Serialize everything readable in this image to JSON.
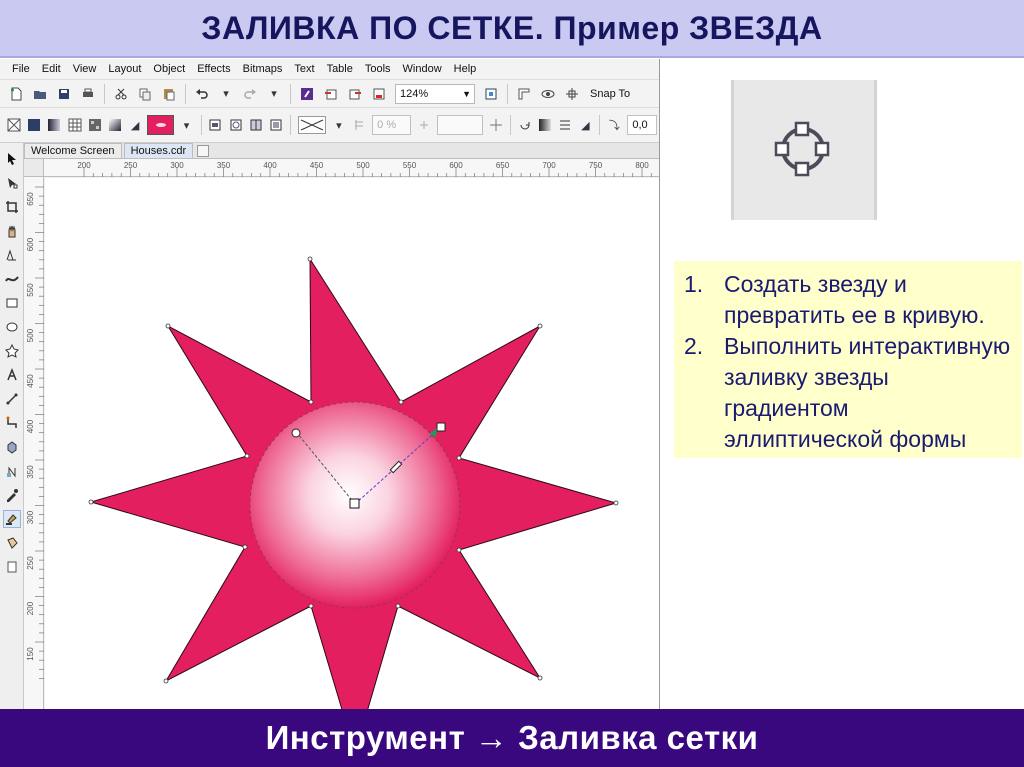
{
  "slide": {
    "title": "ЗАЛИВКА ПО СЕТКЕ. Пример ЗВЕЗДА",
    "footer": "Инструмент → Заливка сетки"
  },
  "app": {
    "menu": [
      "File",
      "Edit",
      "View",
      "Layout",
      "Object",
      "Effects",
      "Bitmaps",
      "Text",
      "Table",
      "Tools",
      "Window",
      "Help"
    ],
    "zoom": "124%",
    "snap_label": "Snap To",
    "percent_field": "0 %",
    "angle_field": "0,0",
    "tabs": [
      "Welcome Screen",
      "Houses.cdr"
    ],
    "hruler_ticks": [
      "200",
      "250",
      "300",
      "350",
      "400",
      "450",
      "500",
      "550",
      "600",
      "650",
      "700",
      "750",
      "800"
    ],
    "vruler_ticks": [
      "650",
      "600",
      "550",
      "500",
      "450",
      "400",
      "350",
      "300",
      "250",
      "200",
      "150"
    ]
  },
  "steps": [
    {
      "num": "1.",
      "text": "Создать звезду и превратить ее в кривую."
    },
    {
      "num": "2.",
      "text": "Выполнить интерактивную заливку звезды градиентом эллиптической формы"
    }
  ],
  "colors": {
    "star_fill": "#e41f5f",
    "title_bg": "#c9c9f2",
    "title_text": "#16165f",
    "footer_bg": "#3a087e",
    "steps_bg": "#ffffcc",
    "steps_text": "#1a1a72"
  },
  "icons": {
    "tool_preview": "mesh-fill-node-circle-icon"
  }
}
